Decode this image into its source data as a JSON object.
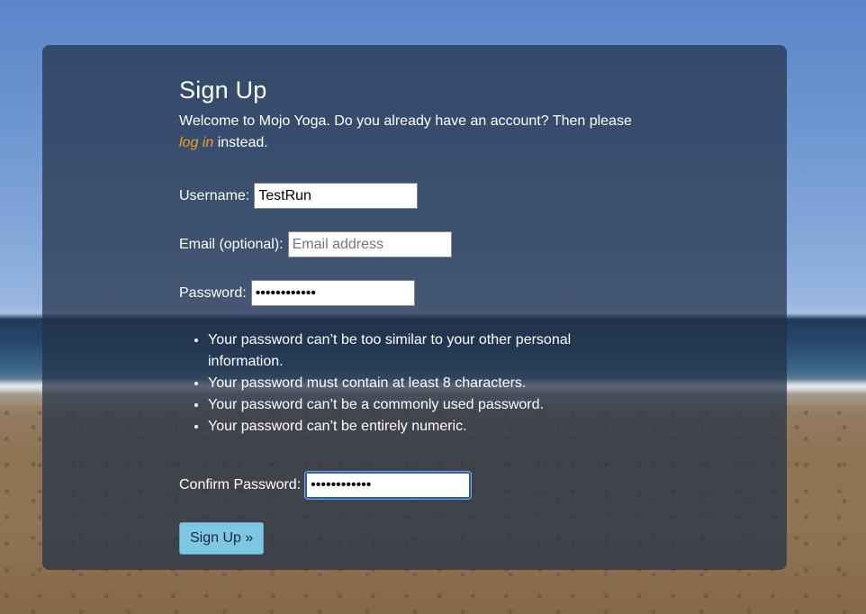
{
  "page": {
    "title": "Sign Up",
    "intro_text": "Welcome to Mojo Yoga. Do you already have an account? Then please",
    "login_link": "log in",
    "intro_suffix": " instead."
  },
  "form": {
    "username": {
      "label": "Username:",
      "value": "TestRun",
      "placeholder": ""
    },
    "email": {
      "label": "Email (optional):",
      "value": "",
      "placeholder": "Email address"
    },
    "password": {
      "label": "Password:",
      "value": "••••••••••••"
    },
    "confirm_password": {
      "label": "Confirm Password:",
      "value": "••••••••••••"
    },
    "password_help": [
      "Your password can’t be too similar to your other personal information.",
      "Your password must contain at least 8 characters.",
      "Your password can’t be a commonly used password.",
      "Your password can’t be entirely numeric."
    ],
    "submit_label": "Sign Up »"
  },
  "colors": {
    "link": "#f0a020",
    "button_bg": "#7ec7e2",
    "panel": "rgba(35,48,70,0.72)"
  }
}
